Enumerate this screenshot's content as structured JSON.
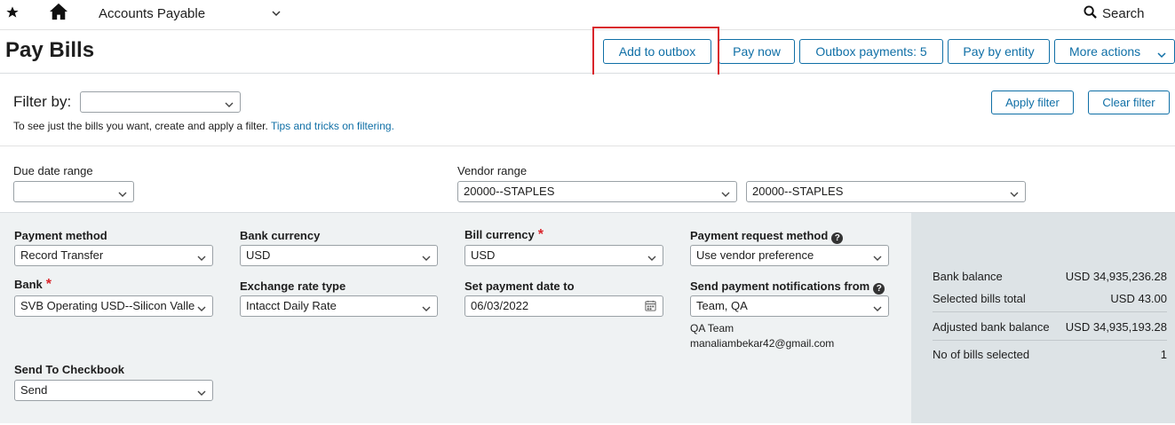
{
  "topbar": {
    "icons": [
      "star-icon",
      "home-icon",
      "chevron-down-icon",
      "search-icon"
    ],
    "module": "Accounts Payable",
    "search_label": "Search"
  },
  "header": {
    "title": "Pay Bills",
    "buttons": {
      "add_to_outbox": "Add to outbox",
      "pay_now": "Pay now",
      "outbox_payments": "Outbox payments: 5",
      "pay_by_entity": "Pay by entity",
      "more_actions": "More actions"
    }
  },
  "filter": {
    "label": "Filter by:",
    "value": "",
    "hint": "To see just the bills you want, create and apply a filter.",
    "tips_link": "Tips and tricks on filtering.",
    "apply": "Apply filter",
    "clear": "Clear filter",
    "due_date_label": "Due date range",
    "due_date_value": "",
    "vendor_label": "Vendor range",
    "vendor_from": "20000--STAPLES",
    "vendor_to": "20000--STAPLES"
  },
  "payment": {
    "payment_method_label": "Payment method",
    "payment_method_value": "Record Transfer",
    "bank_currency_label": "Bank currency",
    "bank_currency_value": "USD",
    "bill_currency_label": "Bill currency",
    "bill_currency_value": "USD",
    "request_method_label": "Payment request method",
    "request_method_value": "Use vendor preference",
    "bank_label": "Bank",
    "bank_value": "SVB Operating USD--Silicon Valle",
    "exchange_rate_label": "Exchange rate type",
    "exchange_rate_value": "Intacct Daily Rate",
    "payment_date_label": "Set payment date to",
    "payment_date_value": "06/03/2022",
    "notify_label": "Send payment notifications from",
    "notify_value": "Team, QA",
    "notify_name": "QA Team",
    "notify_email": "manaliambekar42@gmail.com",
    "checkbook_label": "Send To Checkbook",
    "checkbook_value": "Send"
  },
  "summary": {
    "bank_balance_label": "Bank balance",
    "bank_balance_value": "USD 34,935,236.28",
    "selected_total_label": "Selected bills total",
    "selected_total_value": "USD 43.00",
    "adjusted_label": "Adjusted bank balance",
    "adjusted_value": "USD 34,935,193.28",
    "count_label": "No of bills selected",
    "count_value": "1"
  },
  "colors": {
    "accent": "#0f6fa6",
    "highlight": "#d9252b",
    "panel": "#eff2f3",
    "summary_panel": "#dde3e6"
  }
}
